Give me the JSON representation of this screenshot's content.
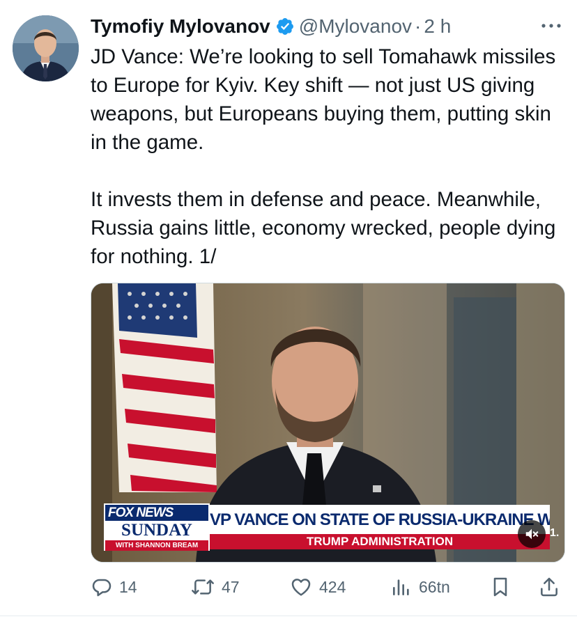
{
  "colors": {
    "verified": "#1d9bf0",
    "text": "#0f1419",
    "secondary": "#536471",
    "fox_blue": "#0a2a6e",
    "fox_red": "#c8102e"
  },
  "tweet": {
    "author_name": "Tymofiy Mylovanov",
    "handle": "@Mylovanov",
    "separator": "·",
    "time": "2 h",
    "more_icon": "more-dots-icon",
    "paragraphs": [
      "JD Vance: We’re looking to sell Tomahawk missiles to Europe for Kyiv. Key shift — not just US giving weapons, but Europeans buying them, putting skin in the game.",
      "It invests them in defense and peace. Meanwhile, Russia gains little, economy wrecked, people dying for nothing. 1/"
    ]
  },
  "video": {
    "brand_line1": "FOX NEWS",
    "brand_line2": "SUNDAY",
    "brand_line3": "WITH SHANNON BREAM",
    "headline": "VP VANCE ON STATE OF RUSSIA-UKRAINE WAR",
    "subheadline": "TRUMP ADMINISTRATION",
    "mute_icon": "speaker-muted-icon",
    "playback_speed": "1."
  },
  "actions": {
    "reply": {
      "icon": "reply-icon",
      "count": "14"
    },
    "retweet": {
      "icon": "retweet-icon",
      "count": "47"
    },
    "like": {
      "icon": "heart-icon",
      "count": "424"
    },
    "views": {
      "icon": "views-chart-icon",
      "count": "66tn"
    },
    "bookmark": {
      "icon": "bookmark-icon"
    },
    "share": {
      "icon": "share-icon"
    }
  }
}
